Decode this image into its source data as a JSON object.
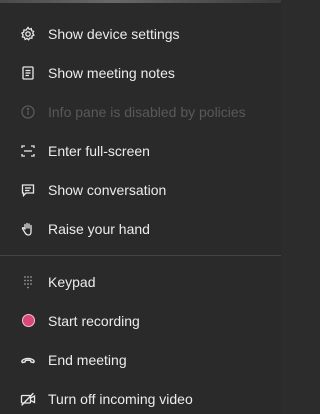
{
  "menu": {
    "items": [
      {
        "label": "Show device settings",
        "icon": "gear-icon",
        "enabled": true
      },
      {
        "label": "Show meeting notes",
        "icon": "notes-icon",
        "enabled": true
      },
      {
        "label": "Info pane is disabled by policies",
        "icon": "info-icon",
        "enabled": false
      },
      {
        "label": "Enter full-screen",
        "icon": "fullscreen-icon",
        "enabled": true
      },
      {
        "label": "Show conversation",
        "icon": "chat-icon",
        "enabled": true
      },
      {
        "label": "Raise your hand",
        "icon": "hand-icon",
        "enabled": true
      }
    ],
    "items2": [
      {
        "label": "Keypad",
        "icon": "keypad-icon",
        "enabled": true
      },
      {
        "label": "Start recording",
        "icon": "record-icon",
        "enabled": true
      },
      {
        "label": "End meeting",
        "icon": "hangup-icon",
        "enabled": true
      },
      {
        "label": "Turn off incoming video",
        "icon": "video-off-icon",
        "enabled": true
      }
    ]
  },
  "colors": {
    "background": "#2b2a2a",
    "text": "#ececec",
    "disabled_text": "#5a5858",
    "record_dot": "#d9487a"
  }
}
